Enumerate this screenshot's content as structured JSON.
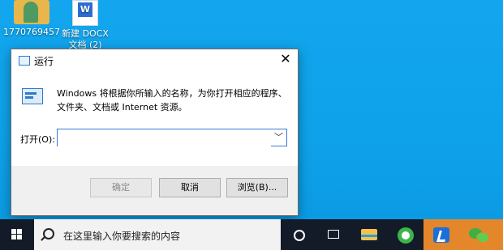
{
  "desktop": {
    "icons": [
      {
        "label": "1770769457"
      },
      {
        "label_line1": "新建 DOCX",
        "label_line2": "文档 (2)"
      }
    ]
  },
  "dialog": {
    "title": "运行",
    "close_glyph": "✕",
    "description": "Windows 将根据你所输入的名称，为你打开相应的程序、文件夹、文档或 Internet 资源。",
    "open_label": "打开(O):",
    "open_value": "",
    "buttons": {
      "ok": "确定",
      "cancel": "取消",
      "browse": "浏览(B)..."
    }
  },
  "taskbar": {
    "search_placeholder": "在这里输入你要搜索的内容",
    "icons": [
      "windows-start-icon",
      "search-icon",
      "cortana-icon",
      "task-view-icon",
      "file-explorer-icon",
      "browser-icon",
      "app-icon",
      "wechat-icon"
    ]
  },
  "colors": {
    "desktop_bg": "#13a6ee",
    "taskbar_bg": "#141b28",
    "highlight": "#e4862a",
    "focus_border": "#3c78d8"
  }
}
